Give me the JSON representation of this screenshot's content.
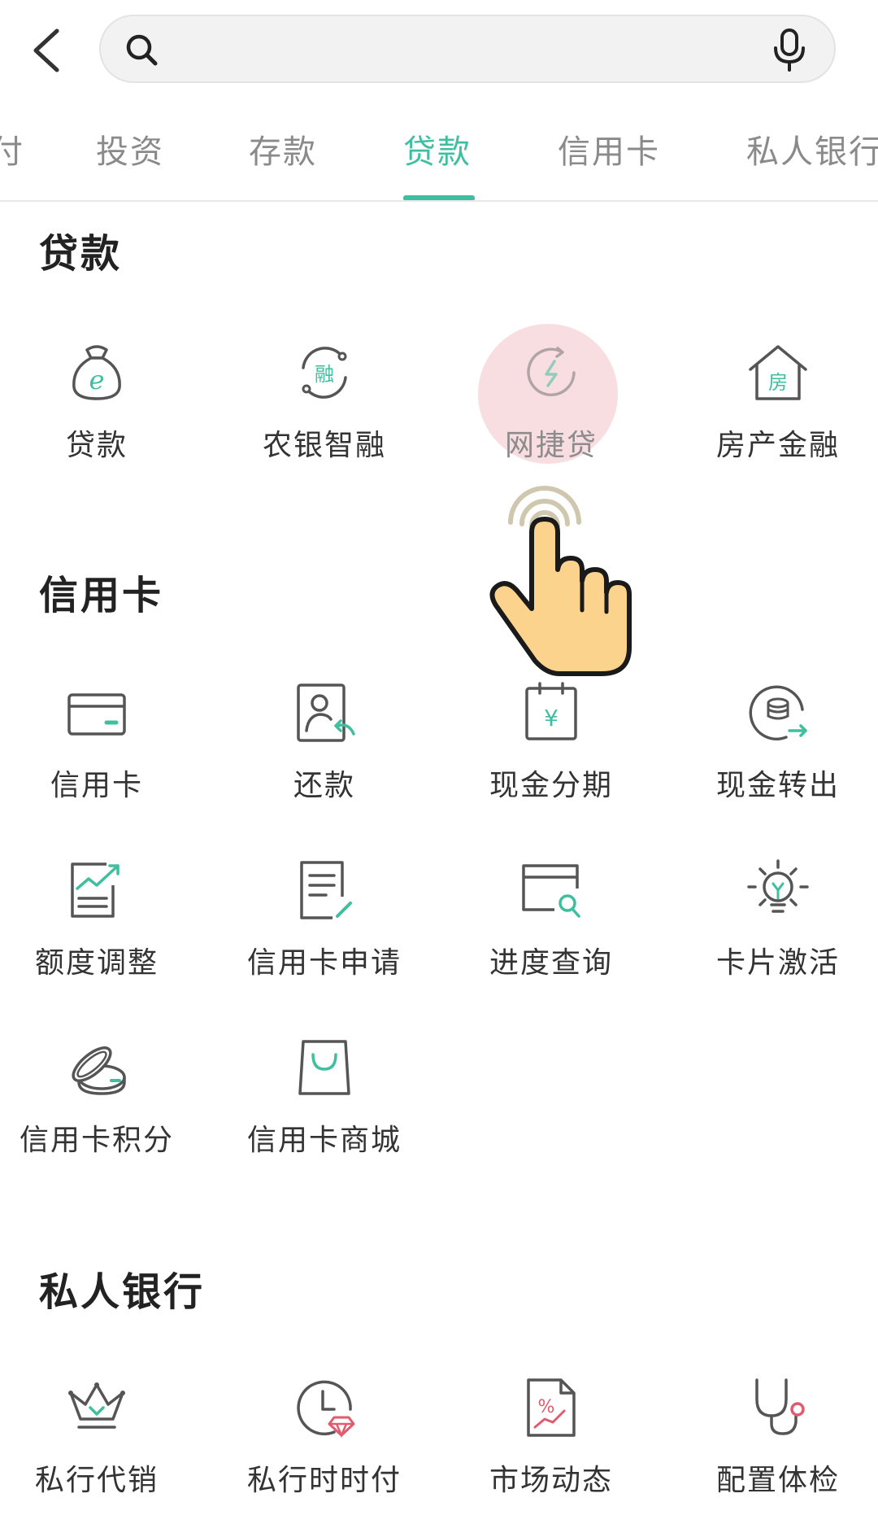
{
  "search": {
    "placeholder": "",
    "value": ""
  },
  "tabs": [
    {
      "label": "付",
      "active": false
    },
    {
      "label": "投资",
      "active": false
    },
    {
      "label": "存款",
      "active": false
    },
    {
      "label": "贷款",
      "active": true
    },
    {
      "label": "信用卡",
      "active": false
    },
    {
      "label": "私人银行",
      "active": false
    }
  ],
  "sections": {
    "loan": {
      "title": "贷款",
      "items": [
        {
          "label": "贷款",
          "icon": "money-bag-icon"
        },
        {
          "label": "农银智融",
          "icon": "rong-exchange-icon"
        },
        {
          "label": "网捷贷",
          "icon": "lightning-cycle-icon"
        },
        {
          "label": "房产金融",
          "icon": "house-icon"
        }
      ]
    },
    "credit": {
      "title": "信用卡",
      "items": [
        {
          "label": "信用卡",
          "icon": "credit-card-icon"
        },
        {
          "label": "还款",
          "icon": "repayment-icon"
        },
        {
          "label": "现金分期",
          "icon": "cash-installment-icon"
        },
        {
          "label": "现金转出",
          "icon": "cash-transfer-icon"
        },
        {
          "label": "额度调整",
          "icon": "limit-adjust-icon"
        },
        {
          "label": "信用卡申请",
          "icon": "card-apply-icon"
        },
        {
          "label": "进度查询",
          "icon": "progress-search-icon"
        },
        {
          "label": "卡片激活",
          "icon": "lightbulb-icon"
        },
        {
          "label": "信用卡积分",
          "icon": "points-coin-icon"
        },
        {
          "label": "信用卡商城",
          "icon": "shopping-bag-icon"
        }
      ]
    },
    "private": {
      "title": "私人银行",
      "items": [
        {
          "label": "私行代销",
          "icon": "crown-icon"
        },
        {
          "label": "私行时时付",
          "icon": "clock-diamond-icon"
        },
        {
          "label": "市场动态",
          "icon": "market-document-icon"
        },
        {
          "label": "配置体检",
          "icon": "stethoscope-icon"
        }
      ]
    }
  },
  "colors": {
    "accent": "#3fbf9f",
    "icon_stroke": "#555555",
    "tap_highlight": "#f7d7dc",
    "hand_fill": "#fbd38d"
  }
}
